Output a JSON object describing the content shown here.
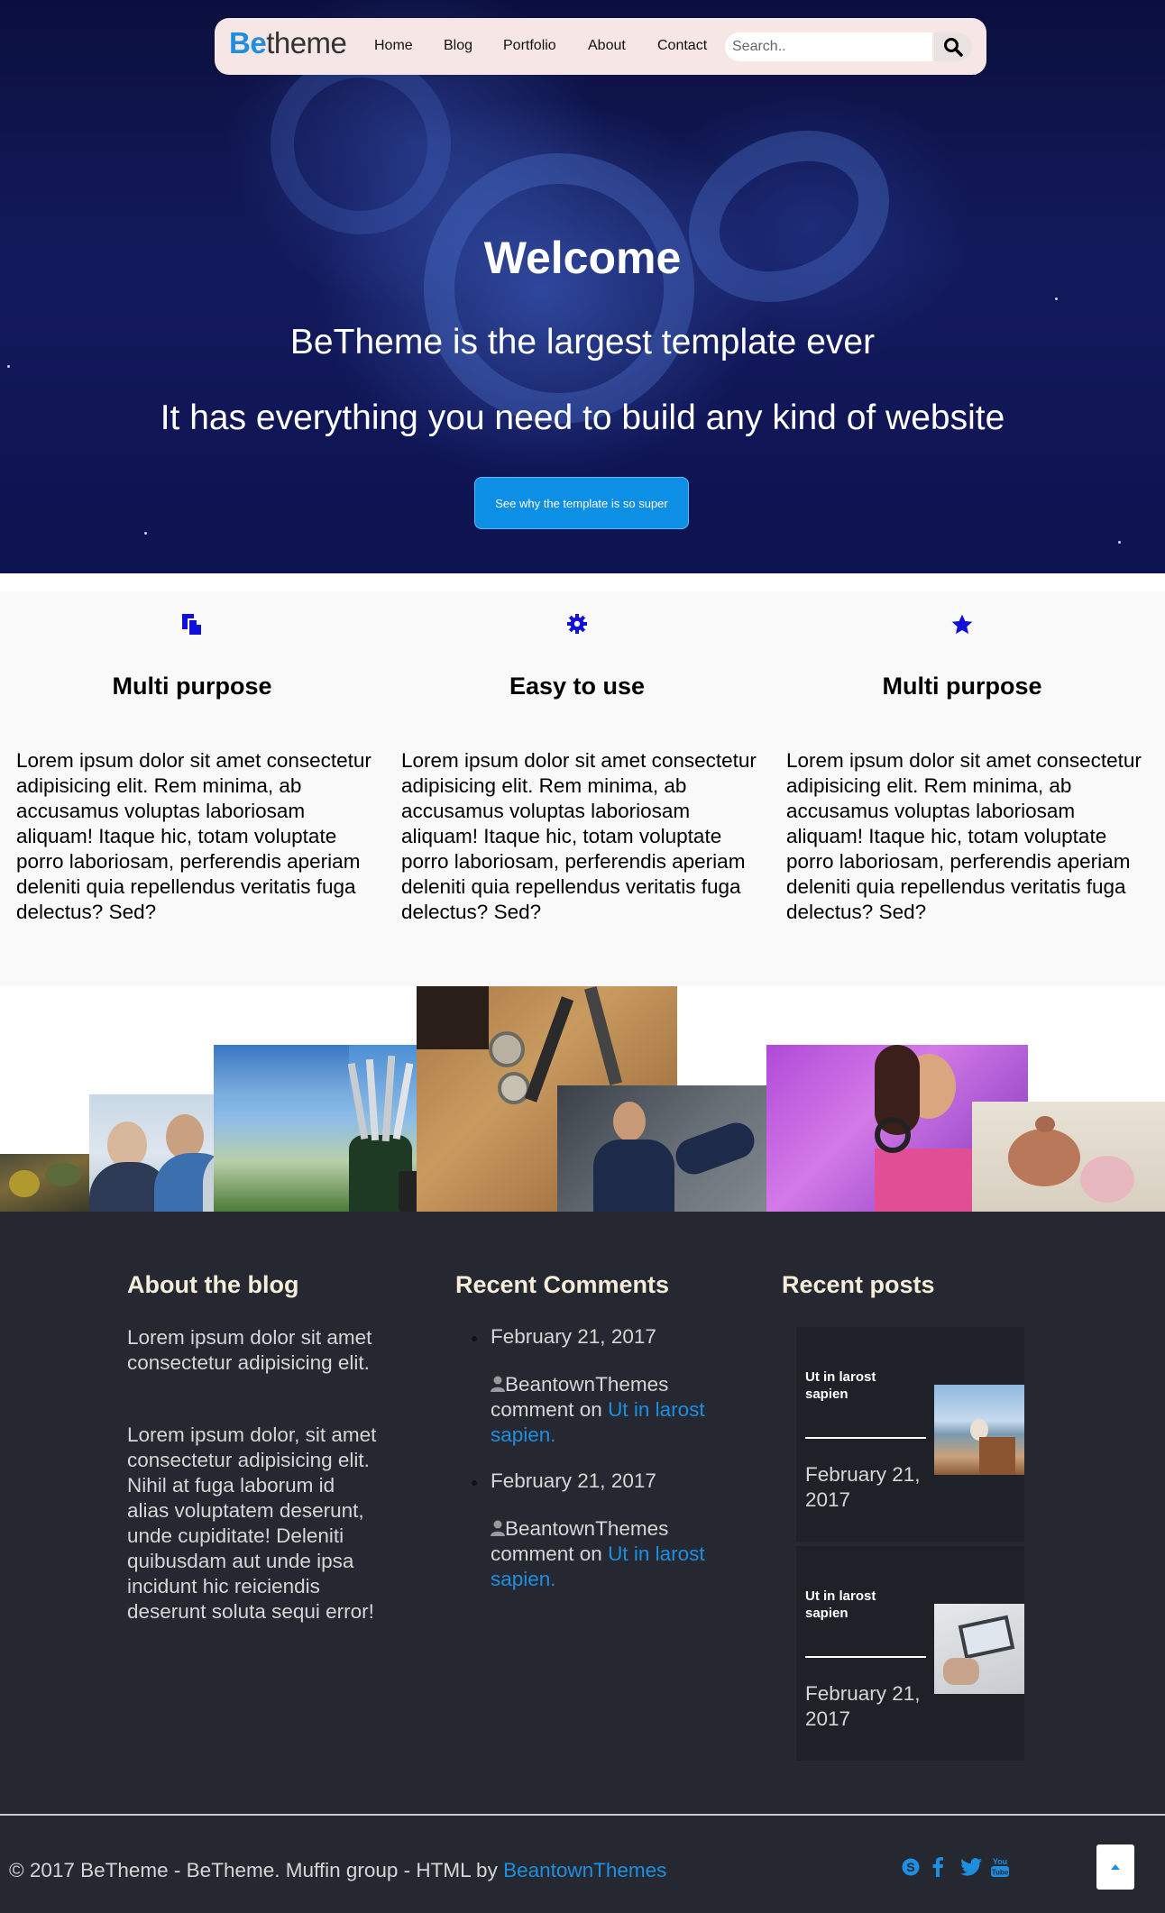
{
  "nav": {
    "logo_be": "Be",
    "logo_theme": "theme",
    "items": [
      "Home",
      "Blog",
      "Portfolio",
      "About",
      "Contact"
    ],
    "search_placeholder": "Search.."
  },
  "hero": {
    "title": "Welcome",
    "subtitle1": "BeTheme is the largest template ever",
    "subtitle2": "It has everything you need to build any kind of website",
    "button_label": "See why the template is so super"
  },
  "features": [
    {
      "icon": "files-icon",
      "title": "Multi purpose",
      "text": "Lorem ipsum dolor sit amet consectetur adipisicing elit. Rem minima, ab accusamus voluptas laboriosam aliquam! Itaque hic, totam voluptate porro laboriosam, perferendis aperiam deleniti quia repellendus veritatis fuga delectus? Sed?"
    },
    {
      "icon": "gear-icon",
      "title": "Easy to use",
      "text": "Lorem ipsum dolor sit amet consectetur adipisicing elit. Rem minima, ab accusamus voluptas laboriosam aliquam! Itaque hic, totam voluptate porro laboriosam, perferendis aperiam deleniti quia repellendus veritatis fuga delectus? Sed?"
    },
    {
      "icon": "star-icon",
      "title": "Multi purpose",
      "text": "Lorem ipsum dolor sit amet consectetur adipisicing elit. Rem minima, ab accusamus voluptas laboriosam aliquam! Itaque hic, totam voluptate porro laboriosam, perferendis aperiam deleniti quia repellendus veritatis fuga delectus? Sed?"
    }
  ],
  "footer": {
    "about": {
      "title": "About the blog",
      "p1": "Lorem ipsum dolor sit amet consectetur adipisicing elit.",
      "p2": "Lorem ipsum dolor, sit amet consectetur adipisicing elit. Nihil at fuga laborum id alias voluptatem deserunt, unde cupiditate! Deleniti quibusdam aut unde ipsa incidunt hic reiciendis deserunt soluta sequi error!"
    },
    "comments": {
      "title": "Recent Comments",
      "items": [
        {
          "date": "February 21, 2017",
          "author": "BeantownThemes",
          "middle": " comment on ",
          "link": "Ut in larost sapien."
        },
        {
          "date": "February 21, 2017",
          "author": "BeantownThemes",
          "middle": " comment on ",
          "link": "Ut in larost sapien."
        }
      ]
    },
    "posts": {
      "title": "Recent posts",
      "items": [
        {
          "title": "Ut in larost sapien",
          "date": "February 21, 2017"
        },
        {
          "title": "Ut in larost sapien",
          "date": "February 21, 2017"
        }
      ]
    },
    "copyright_text": "© 2017 BeTheme - BeTheme. Muffin group - HTML by ",
    "copyright_link": "BeantownThemes",
    "social_icons": [
      "skype-icon",
      "facebook-icon",
      "twitter-icon",
      "youtube-icon"
    ]
  },
  "colors": {
    "accent": "#1e8fe0",
    "feature_icon": "#1010d8",
    "footer_bg": "#252830",
    "footer_title": "#f5ecd9"
  }
}
